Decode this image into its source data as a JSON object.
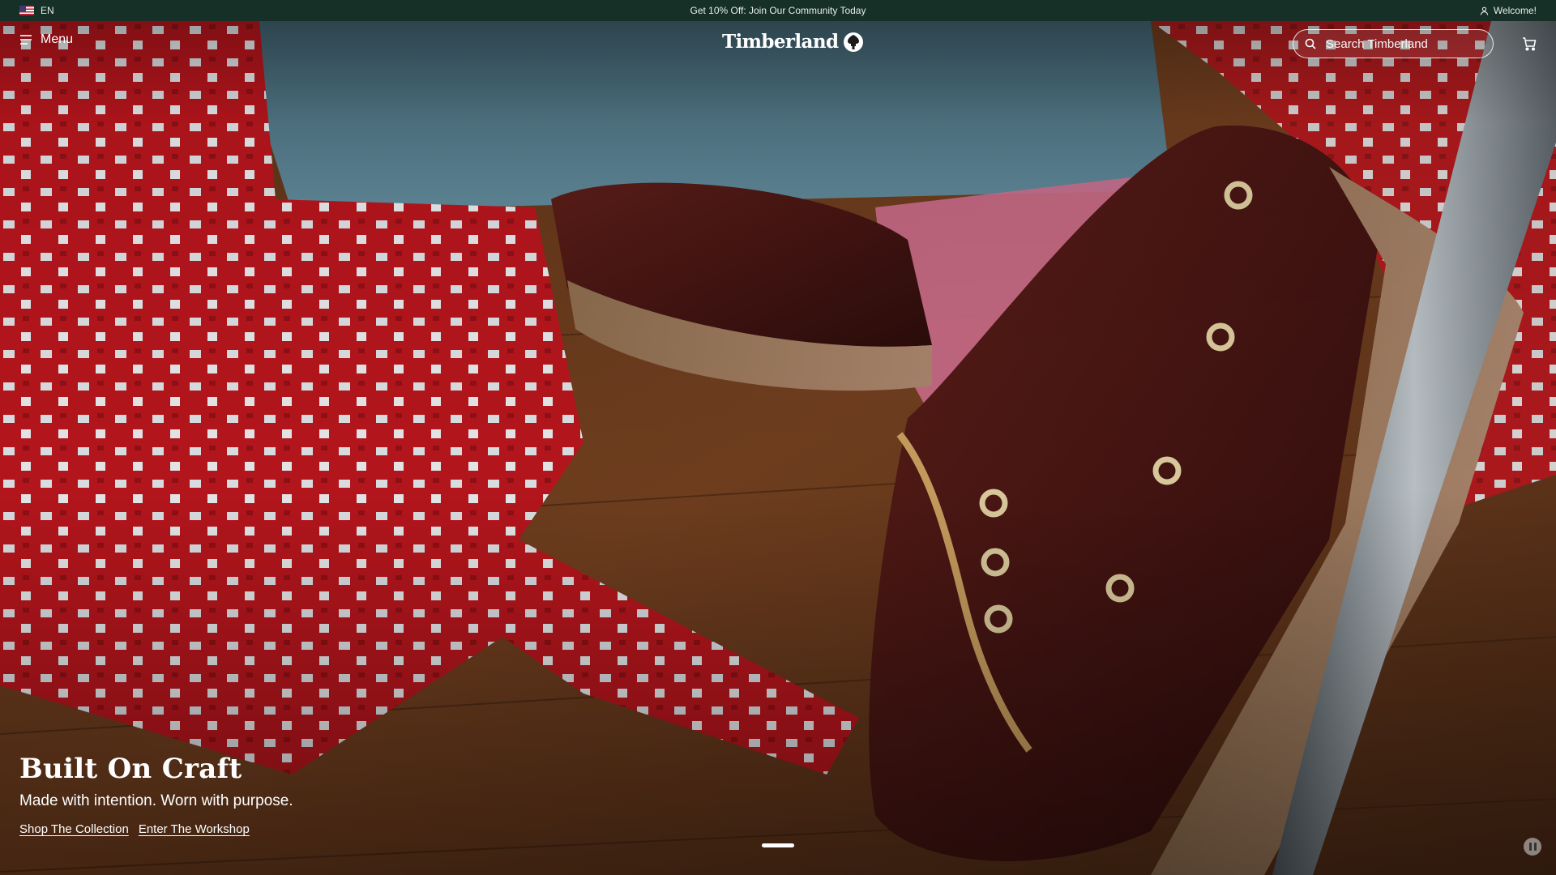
{
  "promo": {
    "language": "EN",
    "message": "Get 10% Off: Join Our Community Today",
    "account": "Welcome!"
  },
  "header": {
    "menu_label": "Menu",
    "logo_text": "Timberland",
    "search_placeholder": "Search Timberland"
  },
  "hero": {
    "title": "Built On Craft",
    "subtitle": "Made with intention. Worn with purpose.",
    "links": [
      "Shop The Collection",
      "Enter The Workshop"
    ]
  },
  "colors": {
    "promo_bar": "#163027",
    "text": "#ffffff"
  },
  "icons": [
    "us-flag-icon",
    "user-icon",
    "hamburger-menu-icon",
    "tree-logo-icon",
    "search-icon",
    "cart-icon",
    "pause-icon"
  ]
}
